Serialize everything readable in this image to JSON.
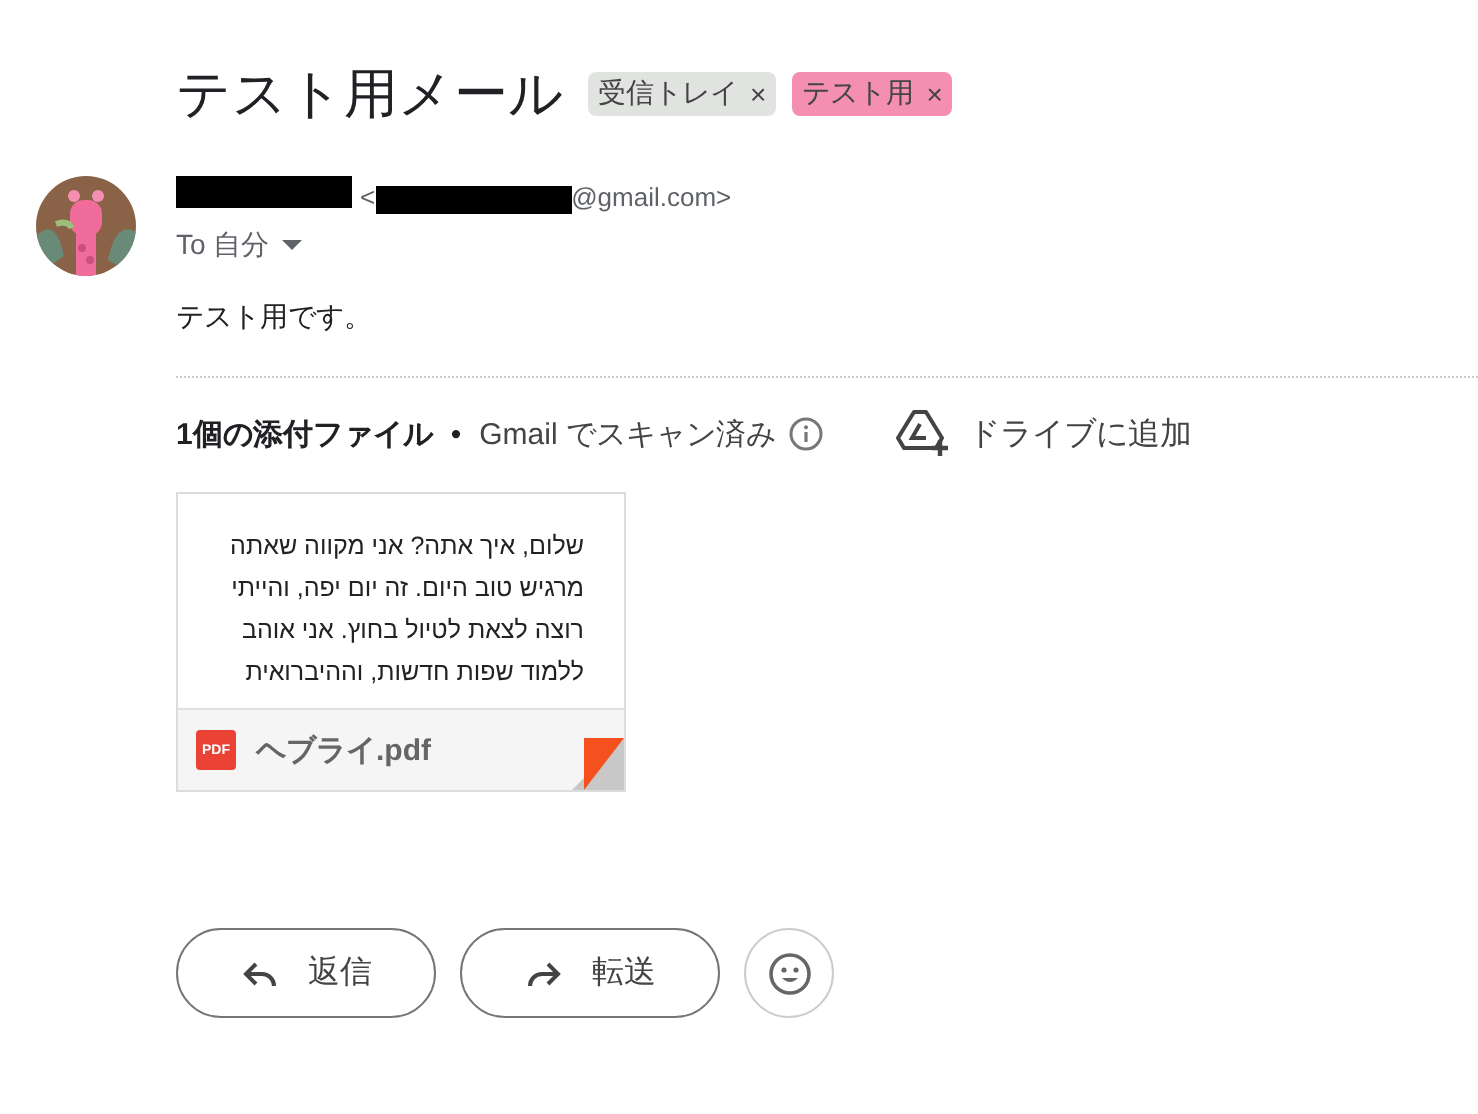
{
  "subject": "テスト用メール",
  "labels": [
    {
      "text": "受信トレイ",
      "close": "×",
      "color": "#e1e3e1"
    },
    {
      "text": "テスト用",
      "close": "×",
      "color": "#f48fb1"
    }
  ],
  "sender": {
    "email_open": "<",
    "email_domain": "@gmail.com>",
    "recipient": "To 自分"
  },
  "body": "テスト用です。",
  "attachments_header": {
    "count": "1個の添付ファイル",
    "separator": "•",
    "scan": "Gmail でスキャン済み",
    "drive": "ドライブに追加"
  },
  "attachment": {
    "preview_lines": [
      "שלום, איך אתה? אני מקווה שאתה",
      "מרגיש טוב היום. זה יום יפה, והייתי",
      "רוצה לצאת לטיול בחוץ. אני אוהב",
      "ללמוד שפות חדשות, וההיברואית"
    ],
    "badge": "PDF",
    "file_name": "ヘブライ.pdf"
  },
  "actions": [
    {
      "label": "返信",
      "kind": "reply"
    },
    {
      "label": "転送",
      "kind": "forward"
    }
  ]
}
